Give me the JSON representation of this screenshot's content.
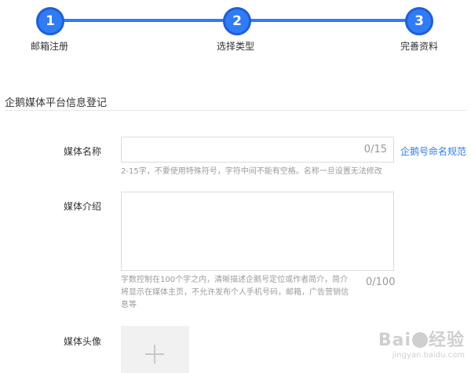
{
  "steps": [
    {
      "number": "1",
      "label": "邮箱注册"
    },
    {
      "number": "2",
      "label": "选择类型"
    },
    {
      "number": "3",
      "label": "完善资料"
    }
  ],
  "section_title": "企鹅媒体平台信息登记",
  "form": {
    "media_name": {
      "label": "媒体名称",
      "value": "",
      "counter": "0/15",
      "hint": "2-15字，不要使用特殊符号，字符中间不能有空格。名称一旦设置无法修改",
      "link": "企鹅号命名规范"
    },
    "media_intro": {
      "label": "媒体介绍",
      "value": "",
      "counter": "0/100",
      "hint": "字数控制在100个字之内，清晰描述企鹅号定位或作者简介，简介将显示在媒体主页，不允许发布个人手机号码，邮箱，广告营销信息等"
    },
    "media_avatar": {
      "label": "媒体头像",
      "upload_icon": "plus-icon"
    }
  },
  "watermark": {
    "main_a": "Bai",
    "main_b": "经验",
    "sub": "jingyan.baidu.com"
  },
  "colors": {
    "accent": "#2f7cf6",
    "border": "#dcdcdc",
    "hint": "#9b9b9b"
  }
}
